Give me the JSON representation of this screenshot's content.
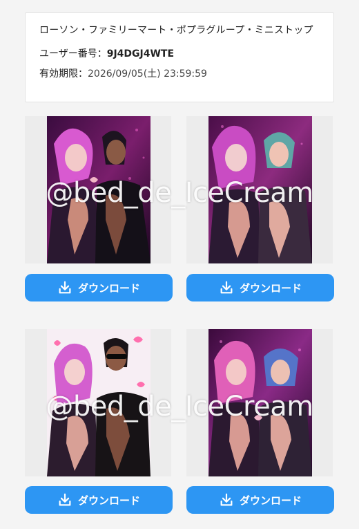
{
  "coupon": {
    "stores": "ローソン・ファミリーマート・ポプラグループ・ミニストップ",
    "user_number_label": "ユーザー番号：",
    "user_number": "9J4DGJ4WTE",
    "expiry_label": "有効期限：",
    "expiry": "2026/09/05(土) 23:59:59"
  },
  "images": [
    {
      "alt": "illustration-1",
      "download_label": "ダウンロード"
    },
    {
      "alt": "illustration-2",
      "download_label": "ダウンロード"
    },
    {
      "alt": "illustration-3",
      "download_label": "ダウンロード"
    },
    {
      "alt": "illustration-4",
      "download_label": "ダウンロード"
    }
  ],
  "watermark": "@bed_de_IceCream",
  "colors": {
    "button": "#2d96f3",
    "page_bg": "#f4f4f4",
    "tile_bg": "#ececec"
  },
  "icons": {
    "download": "download-icon"
  }
}
